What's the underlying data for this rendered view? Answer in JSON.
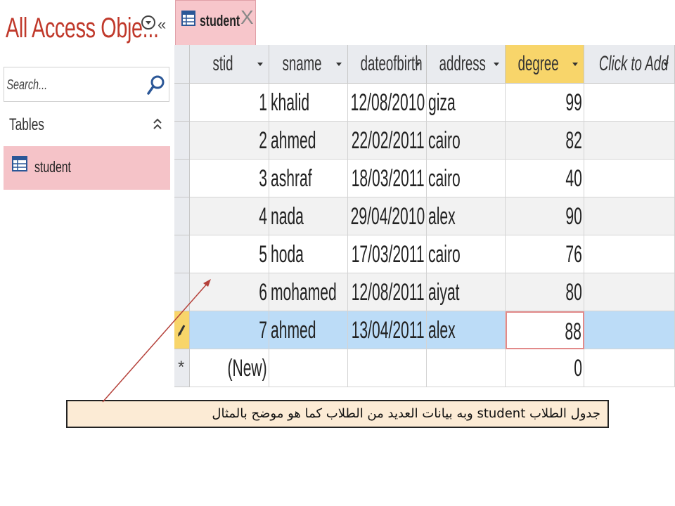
{
  "nav": {
    "title": "All Access Obje...",
    "search_placeholder": "Search...",
    "group_label": "Tables",
    "items": [
      {
        "label": "student"
      }
    ]
  },
  "tab": {
    "label": "student",
    "close": "X"
  },
  "table": {
    "columns": [
      "stid",
      "sname",
      "dateofbirth",
      "address",
      "degree",
      "Click to Add"
    ],
    "rows": [
      {
        "stid": "1",
        "sname": "khalid",
        "dateofbirth": "12/08/2010",
        "address": "giza",
        "degree": "99"
      },
      {
        "stid": "2",
        "sname": "ahmed",
        "dateofbirth": "22/02/2011",
        "address": "cairo",
        "degree": "82"
      },
      {
        "stid": "3",
        "sname": "ashraf",
        "dateofbirth": "18/03/2011",
        "address": "cairo",
        "degree": "40"
      },
      {
        "stid": "4",
        "sname": "nada",
        "dateofbirth": "29/04/2010",
        "address": "alex",
        "degree": "90"
      },
      {
        "stid": "5",
        "sname": "hoda",
        "dateofbirth": "17/03/2011",
        "address": "cairo",
        "degree": "76"
      },
      {
        "stid": "6",
        "sname": "mohamed",
        "dateofbirth": "12/08/2011",
        "address": "aiyat",
        "degree": "80"
      },
      {
        "stid": "7",
        "sname": "ahmed",
        "dateofbirth": "13/04/2011",
        "address": "alex",
        "degree": "88"
      }
    ],
    "new_row": {
      "stid": "(New)",
      "degree": "0"
    },
    "selected_column": "degree",
    "current_row_index": 6
  },
  "callout": {
    "text": "جدول الطلاب student وبه بيانات العديد من الطلاب كما هو موضح بالمثال"
  },
  "colors": {
    "accent": "#c0392b",
    "tab_bg": "#f7c6cb",
    "selected_header": "#f8d56a",
    "current_row": "#bcdcf7",
    "callout_bg": "#fcebd5"
  },
  "icons": {
    "search": "search-icon",
    "table": "table-icon",
    "pencil": "pencil-icon",
    "new_record": "asterisk-icon"
  }
}
